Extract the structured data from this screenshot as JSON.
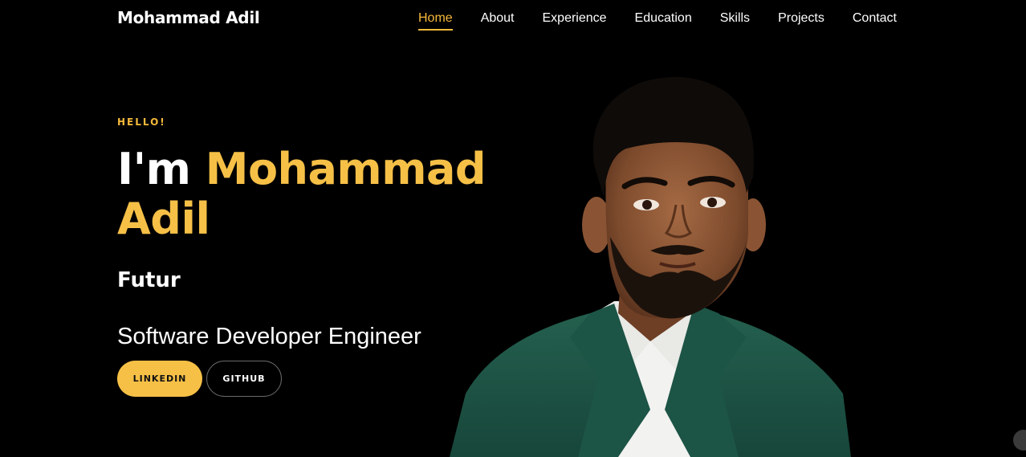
{
  "brand": "Mohammad Adil",
  "nav": {
    "items": [
      {
        "label": "Home",
        "active": true
      },
      {
        "label": "About"
      },
      {
        "label": "Experience"
      },
      {
        "label": "Education"
      },
      {
        "label": "Skills"
      },
      {
        "label": "Projects"
      },
      {
        "label": "Contact"
      }
    ]
  },
  "hero": {
    "greeting": "HELLO!",
    "intro": "I'm",
    "name_line1": "Mohammad",
    "name_line2": "Adil",
    "typed_text": "Futur",
    "role": "Software Developer Engineer",
    "buttons": {
      "linkedin": "LINKEDIN",
      "github": "GITHUB"
    }
  },
  "colors": {
    "accent": "#f6c047",
    "background": "#000000",
    "text": "#ffffff",
    "suit": "#1f5c4a"
  }
}
